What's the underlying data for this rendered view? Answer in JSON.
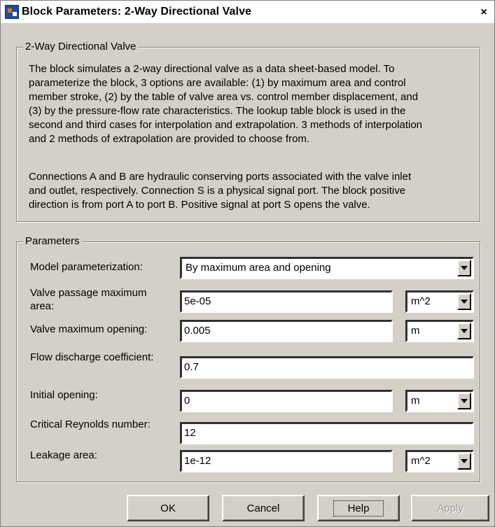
{
  "window": {
    "title": "Block Parameters: 2-Way Directional Valve",
    "close_glyph": "×",
    "app_icon": "simulink-block-icon",
    "close_icon": "close-icon"
  },
  "description": {
    "group_title": "2-Way Directional Valve",
    "para1": [
      "The block simulates a 2-way directional valve as a data sheet-based model. To",
      "parameterize the block, 3 options are available: (1) by maximum area and control",
      "member stroke, (2) by the table of valve area vs. control member displacement, and",
      "(3) by the pressure-flow rate characteristics. The lookup table block is used in the",
      "second and third cases for interpolation and extrapolation. 3 methods of interpolation",
      "and 2 methods of extrapolation are provided to choose from."
    ],
    "para2": [
      "Connections A and B are hydraulic conserving ports associated with the valve inlet",
      "and outlet, respectively. Connection S is a physical signal port. The block positive",
      "direction is from port A to port B. Positive signal at port S opens the valve."
    ]
  },
  "parameters": {
    "group_title": "Parameters",
    "model_parameterization": {
      "label": "Model parameterization:",
      "value": "By maximum area and opening"
    },
    "valve_passage_max_area": {
      "label_line1": "Valve passage maximum",
      "label_line2": "area:",
      "value": "5e-05",
      "unit": "m^2"
    },
    "valve_max_opening": {
      "label": "Valve maximum opening:",
      "value": "0.005",
      "unit": "m"
    },
    "flow_discharge_coeff": {
      "label": "Flow discharge coefficient:",
      "value": "0.7"
    },
    "initial_opening": {
      "label": "Initial opening:",
      "value": "0",
      "unit": "m"
    },
    "critical_reynolds": {
      "label": "Critical Reynolds number:",
      "value": "12"
    },
    "leakage_area": {
      "label": "Leakage area:",
      "value": "1e-12",
      "unit": "m^2"
    }
  },
  "buttons": {
    "ok": "OK",
    "cancel": "Cancel",
    "help": "Help",
    "apply": "Apply"
  }
}
